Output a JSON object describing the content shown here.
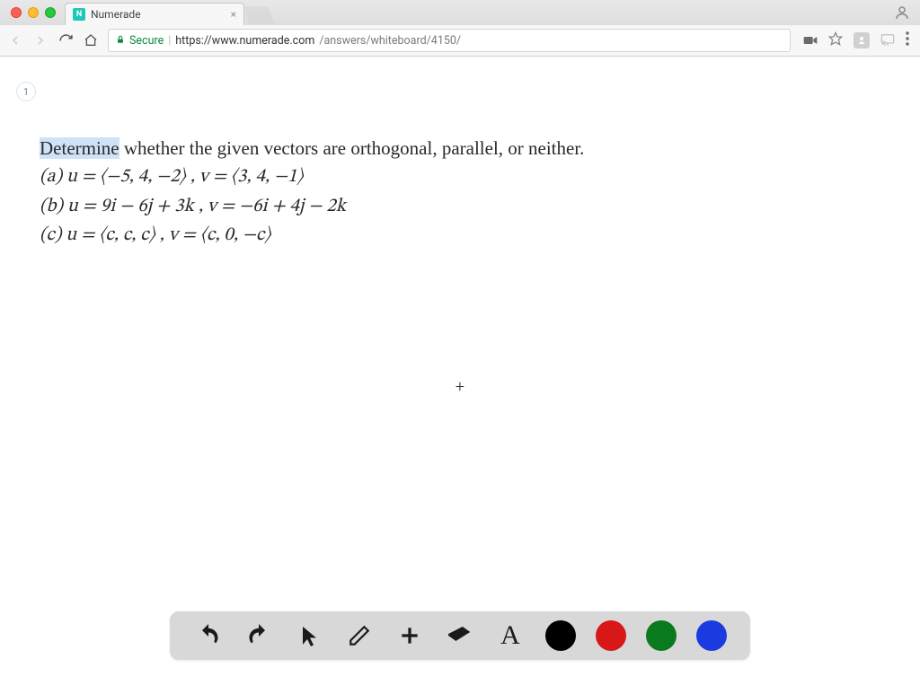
{
  "browser": {
    "tab": {
      "title": "Numerade",
      "favicon_letter": "N"
    },
    "nav": {
      "secure_label": "Secure",
      "url_host": "https://www.numerade.com",
      "url_path": "/answers/whiteboard/4150/"
    }
  },
  "page": {
    "badge": "1",
    "problem": {
      "highlighted_word": "Determine",
      "intro_rest": " whether the given vectors are orthogonal, parallel, or neither.",
      "line_a": "(a) u = ⟨−5, 4, −2⟩ , v = ⟨3, 4, −1⟩",
      "line_b": "(b) u = 9i − 6j + 3k , v = −6i + 4j − 2k",
      "line_c": "(c) u = ⟨c, c, c⟩ , v = ⟨c, 0, −c⟩"
    },
    "crosshair": "+"
  },
  "toolbar": {
    "tools": {
      "undo": "undo",
      "redo": "redo",
      "select": "select",
      "pencil": "pencil",
      "add": "add",
      "eraser": "eraser",
      "text": "A"
    },
    "colors": {
      "black": "#000000",
      "red": "#d81818",
      "green": "#0a7a1e",
      "blue": "#1b3be0"
    }
  }
}
